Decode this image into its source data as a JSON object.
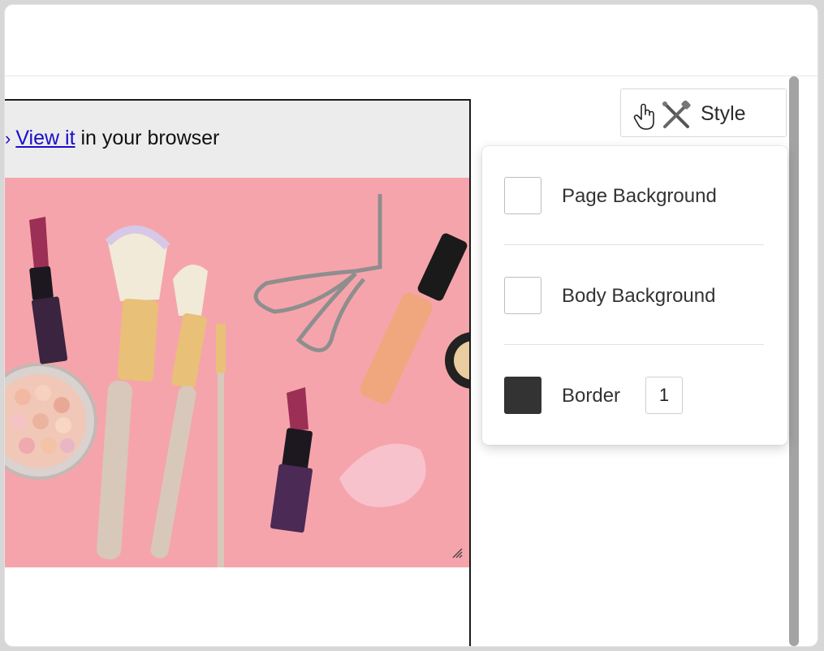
{
  "preheader": {
    "link_text": "View it",
    "suffix": " in your browser"
  },
  "hero": {
    "description_icon": "makeup-products-image"
  },
  "style_button": {
    "label": "Style",
    "icon": "crossed-tools-icon"
  },
  "style_panel": {
    "page_background": {
      "label": "Page Background",
      "color": "#ffffff"
    },
    "body_background": {
      "label": "Body Background",
      "color": "#ffffff"
    },
    "border": {
      "label": "Border",
      "color": "#333333",
      "width": "1"
    }
  }
}
